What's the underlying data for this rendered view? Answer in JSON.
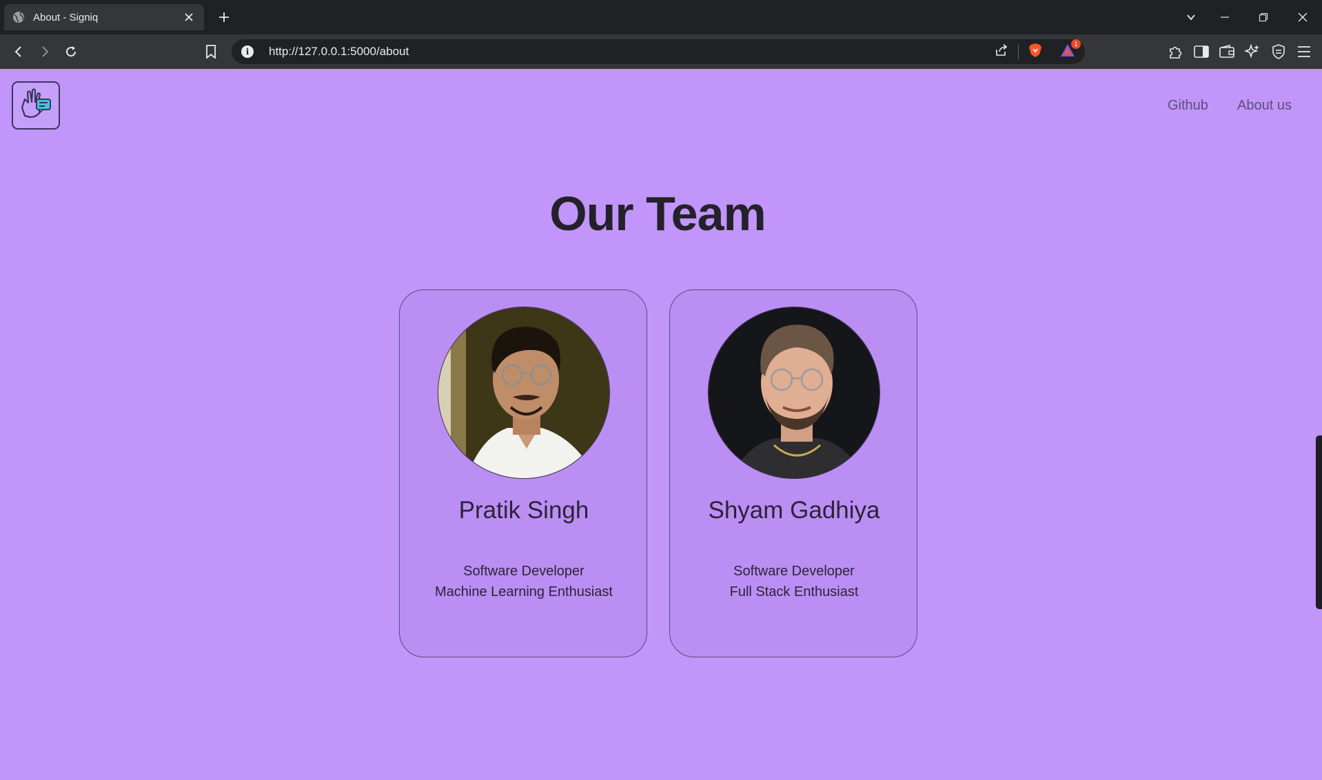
{
  "browser": {
    "tab": {
      "title": "About - Signiq"
    },
    "url": "http://127.0.0.1:5000/about",
    "notification_count": "1"
  },
  "site": {
    "nav": [
      {
        "label": "Github"
      },
      {
        "label": "About us"
      }
    ]
  },
  "main": {
    "heading": "Our Team",
    "team": [
      {
        "name": "Pratik Singh",
        "role_line1": "Software Developer",
        "role_line2": "Machine Learning Enthusiast"
      },
      {
        "name": "Shyam Gadhiya",
        "role_line1": "Software Developer",
        "role_line2": "Full Stack Enthusiast"
      }
    ]
  },
  "colors": {
    "page_background": "#c195f9",
    "card_background": "#bb8ef4",
    "heading_text": "#24212b",
    "chrome_dark": "#202124",
    "chrome_toolbar": "#35363a"
  },
  "icons": [
    "globe-icon",
    "close-icon",
    "plus-icon",
    "chevron-down-icon",
    "minimize-icon",
    "restore-icon",
    "back-icon",
    "forward-icon",
    "reload-icon",
    "bookmark-icon",
    "info-icon",
    "share-icon",
    "brave-shield-icon",
    "brave-rewards-icon",
    "extensions-icon",
    "sidebar-icon",
    "wallet-icon",
    "leo-ai-icon",
    "vpn-icon",
    "menu-icon",
    "sign-language-logo-icon"
  ]
}
